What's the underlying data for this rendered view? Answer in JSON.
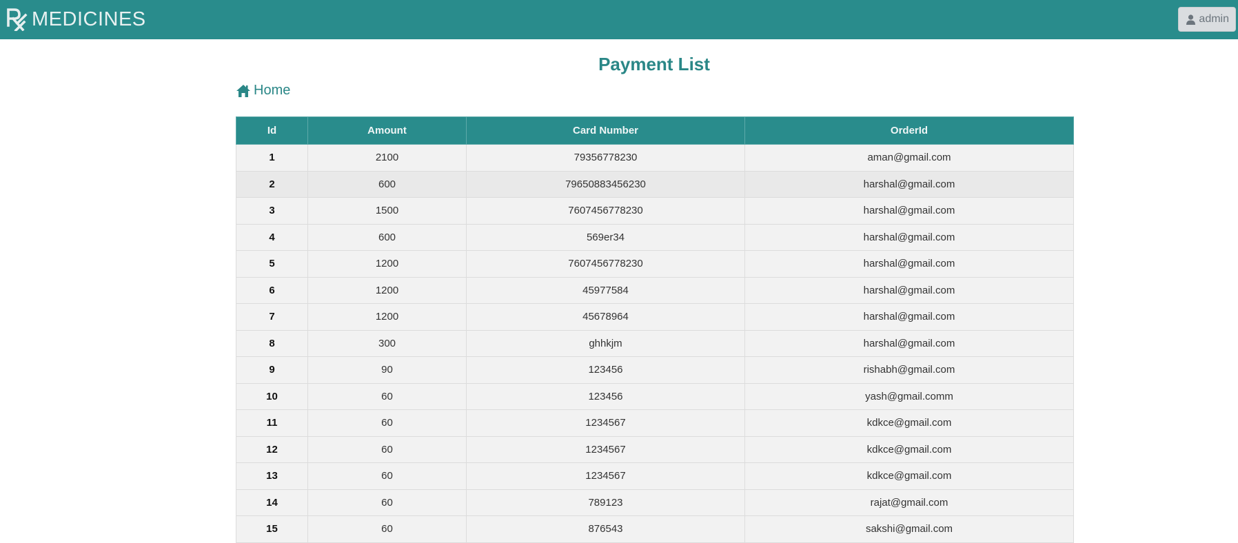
{
  "navbar": {
    "brand_text": "MEDICINES",
    "brand_icon": "rx-icon",
    "user_label": "admin",
    "user_icon": "user-icon"
  },
  "main": {
    "title": "Payment List",
    "home_label": "Home",
    "home_icon": "home-icon"
  },
  "table": {
    "headers": [
      "Id",
      "Amount",
      "Card Number",
      "OrderId"
    ],
    "rows": [
      {
        "id": "1",
        "amount": "2100",
        "card": "79356778230",
        "order": "aman@gmail.com"
      },
      {
        "id": "2",
        "amount": "600",
        "card": "79650883456230",
        "order": "harshal@gmail.com"
      },
      {
        "id": "3",
        "amount": "1500",
        "card": "7607456778230",
        "order": "harshal@gmail.com"
      },
      {
        "id": "4",
        "amount": "600",
        "card": "569er34",
        "order": "harshal@gmail.com"
      },
      {
        "id": "5",
        "amount": "1200",
        "card": "7607456778230",
        "order": "harshal@gmail.com"
      },
      {
        "id": "6",
        "amount": "1200",
        "card": "45977584",
        "order": "harshal@gmail.com"
      },
      {
        "id": "7",
        "amount": "1200",
        "card": "45678964",
        "order": "harshal@gmail.com"
      },
      {
        "id": "8",
        "amount": "300",
        "card": "ghhkjm",
        "order": "harshal@gmail.com"
      },
      {
        "id": "9",
        "amount": "90",
        "card": "123456",
        "order": "rishabh@gmail.com"
      },
      {
        "id": "10",
        "amount": "60",
        "card": "123456",
        "order": "yash@gmail.comm"
      },
      {
        "id": "11",
        "amount": "60",
        "card": "1234567",
        "order": "kdkce@gmail.com"
      },
      {
        "id": "12",
        "amount": "60",
        "card": "1234567",
        "order": "kdkce@gmail.com"
      },
      {
        "id": "13",
        "amount": "60",
        "card": "1234567",
        "order": "kdkce@gmail.com"
      },
      {
        "id": "14",
        "amount": "60",
        "card": "789123",
        "order": "rajat@gmail.com"
      },
      {
        "id": "15",
        "amount": "60",
        "card": "876543",
        "order": "sakshi@gmail.com"
      }
    ]
  },
  "colors": {
    "primary": "#298c8c",
    "title": "#2a8787",
    "row_bg": "#f2f2f2"
  }
}
